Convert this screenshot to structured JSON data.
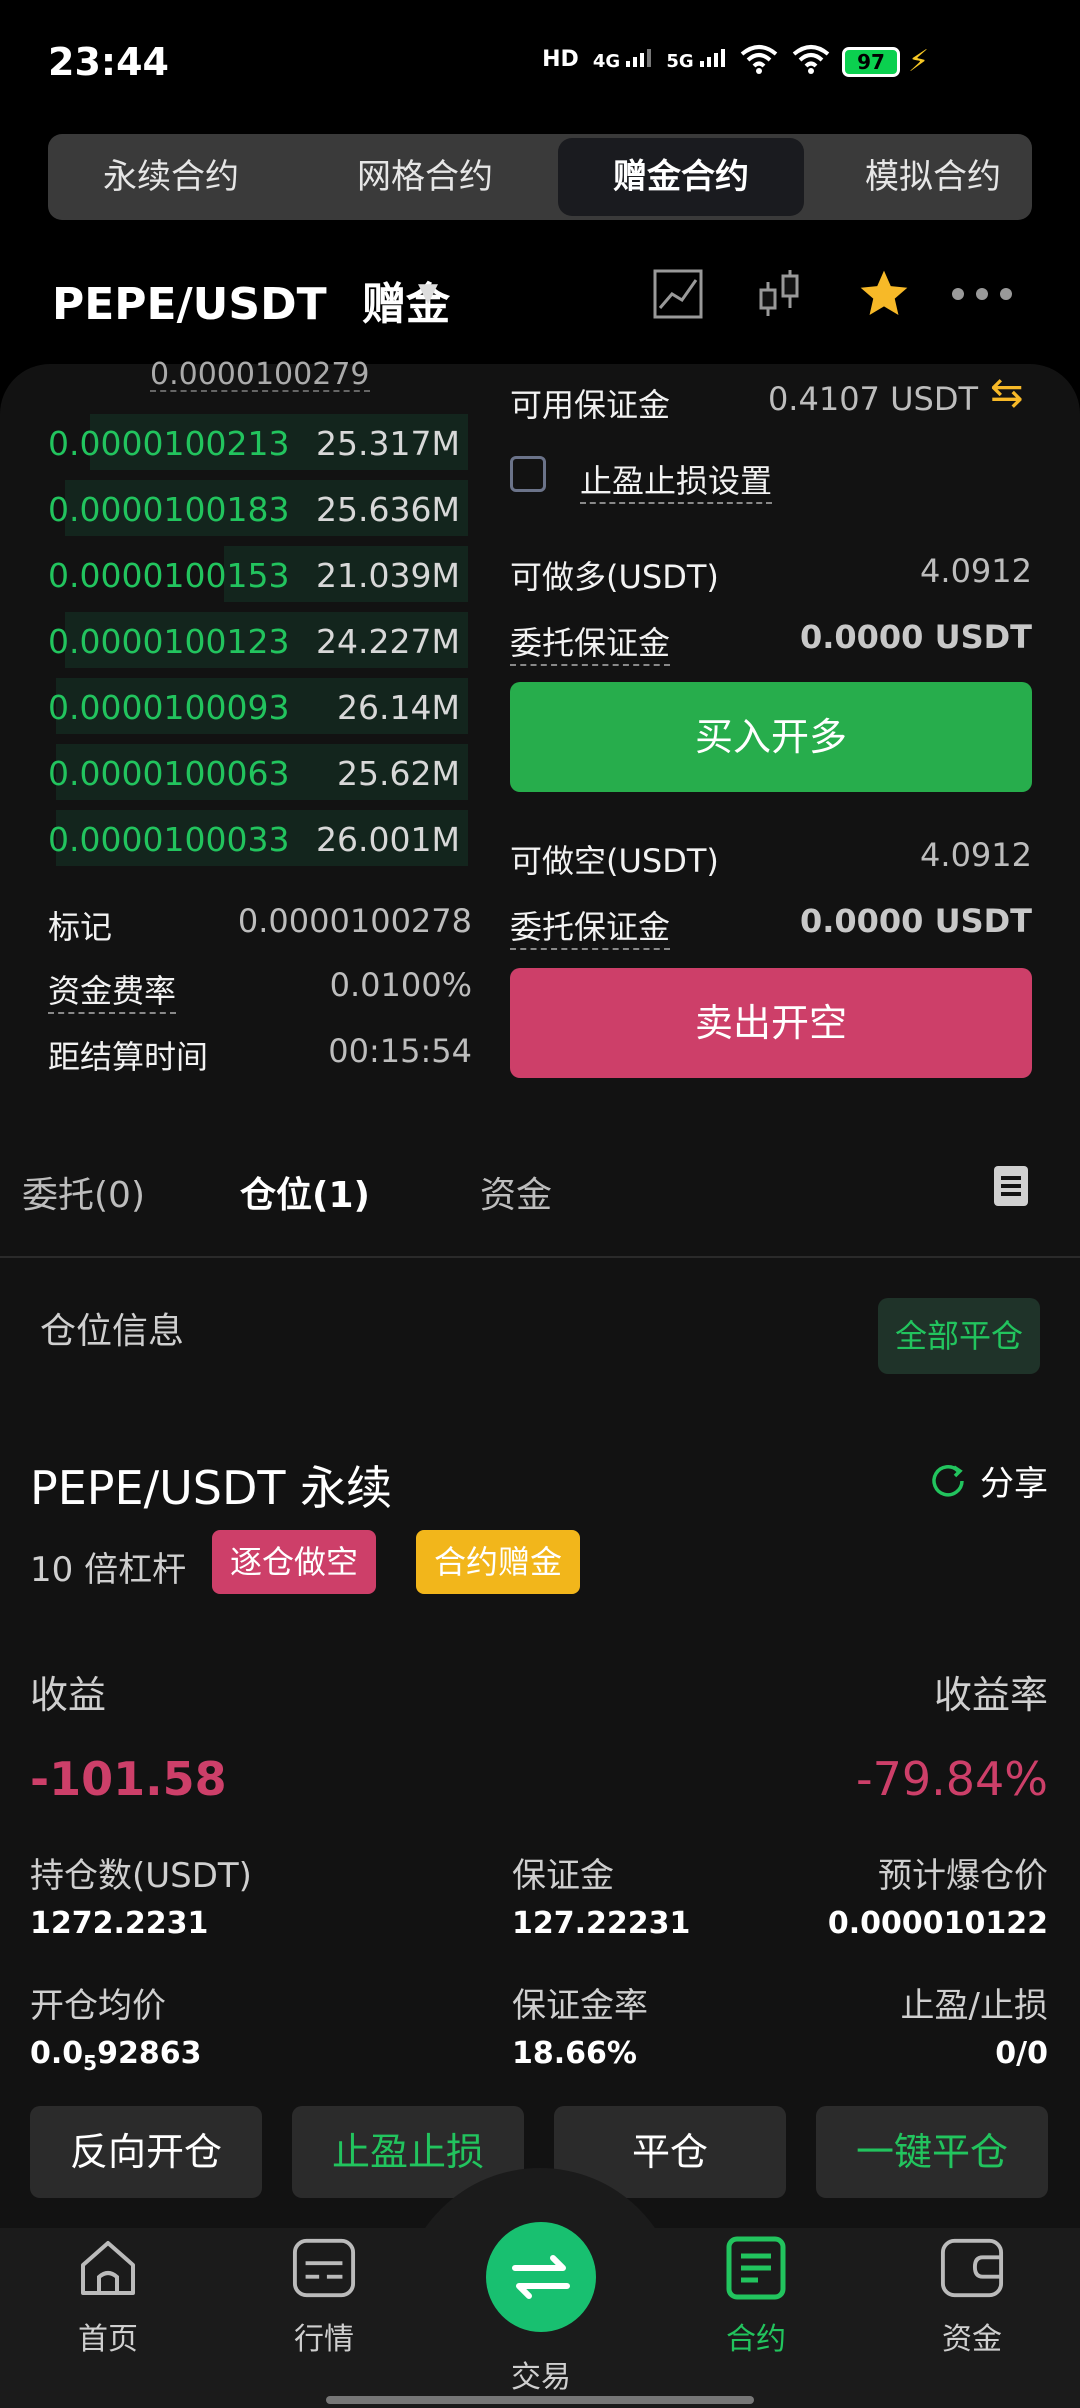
{
  "status_bar": {
    "time": "23:44",
    "battery": "97",
    "icons": [
      "hd-icon",
      "signal-4g-icon",
      "signal-5g-icon",
      "wifi-icon",
      "wifi-icon"
    ],
    "hd_label": "HD",
    "net1_label": "4G",
    "net2_label": "5G"
  },
  "contract_tabs": [
    {
      "label": "永续合约",
      "active": false
    },
    {
      "label": "网格合约",
      "active": false
    },
    {
      "label": "赠金合约",
      "active": true
    },
    {
      "label": "模拟合约",
      "active": false
    }
  ],
  "header": {
    "pair": "PEPE/USDT",
    "mode": "赠金",
    "icons": [
      "chart-icon",
      "candlestick-icon",
      "star-icon",
      "more-icon"
    ]
  },
  "order_book": {
    "top_price": "0.0000100279",
    "rows": [
      {
        "price": "0.0000100213",
        "qty": "25.317M",
        "depth": 0.9
      },
      {
        "price": "0.0000100183",
        "qty": "25.636M",
        "depth": 0.96
      },
      {
        "price": "0.0000100153",
        "qty": "21.039M",
        "depth": 0.58
      },
      {
        "price": "0.0000100123",
        "qty": "24.227M",
        "depth": 0.96
      },
      {
        "price": "0.0000100093",
        "qty": "26.14M",
        "depth": 0.98
      },
      {
        "price": "0.0000100063",
        "qty": "25.62M",
        "depth": 0.98
      },
      {
        "price": "0.0000100033",
        "qty": "26.001M",
        "depth": 0.98
      }
    ]
  },
  "market_info": {
    "mark_label": "标记",
    "mark_value": "0.0000100278",
    "funding_label": "资金费率",
    "funding_value": "0.0100%",
    "settle_label": "距结算时间",
    "settle_value": "00:15:54"
  },
  "order_form": {
    "available_label": "可用保证金",
    "available_value": "0.4107 USDT",
    "tpsl_label": "止盈止损设置",
    "long_max_label": "可做多(USDT)",
    "long_max_value": "4.0912",
    "long_margin_label": "委托保证金",
    "long_margin_value": "0.0000 USDT",
    "buy_button": "买入开多",
    "short_max_label": "可做空(USDT)",
    "short_max_value": "4.0912",
    "short_margin_label": "委托保证金",
    "short_margin_value": "0.0000 USDT",
    "sell_button": "卖出开空"
  },
  "sub_tabs": [
    {
      "label": "委托(0)",
      "active": false
    },
    {
      "label": "仓位(1)",
      "active": true
    },
    {
      "label": "资金",
      "active": false
    }
  ],
  "position": {
    "section_title": "仓位信息",
    "close_all": "全部平仓",
    "title": "PEPE/USDT 永续",
    "share": "分享",
    "leverage": "10 倍杠杆",
    "tag_side": "逐仓做空",
    "tag_bonus": "合约赠金",
    "pnl_label": "收益",
    "pnl_rate_label": "收益率",
    "pnl_value": "-101.58",
    "pnl_rate_value": "-79.84%",
    "size_label": "持仓数(USDT)",
    "size_value": "1272.2231",
    "margin_label": "保证金",
    "margin_value": "127.22231",
    "liq_label": "预计爆仓价",
    "liq_value": "0.000010122",
    "entry_label": "开仓均价",
    "entry_value_prefix": "0.0",
    "entry_value_sub": "5",
    "entry_value_suffix": "92863",
    "margin_rate_label": "保证金率",
    "margin_rate_value": "18.66%",
    "tpsl_label": "止盈/止损",
    "tpsl_value": "0/0"
  },
  "actions": [
    {
      "label": "反向开仓",
      "green": false
    },
    {
      "label": "止盈止损",
      "green": true
    },
    {
      "label": "平仓",
      "green": false
    },
    {
      "label": "一键平仓",
      "green": true
    }
  ],
  "bottom_nav": [
    {
      "label": "首页",
      "icon": "home-icon",
      "active": false
    },
    {
      "label": "行情",
      "icon": "market-icon",
      "active": false
    },
    {
      "label": "交易",
      "icon": "swap-icon",
      "active": false
    },
    {
      "label": "合约",
      "icon": "contract-icon",
      "active": true
    },
    {
      "label": "资金",
      "icon": "wallet-icon",
      "active": false
    }
  ],
  "colors": {
    "green": "#22c45e",
    "red": "#cd3f69",
    "yellow": "#f2b61b",
    "buy": "#27ad4c",
    "background": "#121212"
  }
}
